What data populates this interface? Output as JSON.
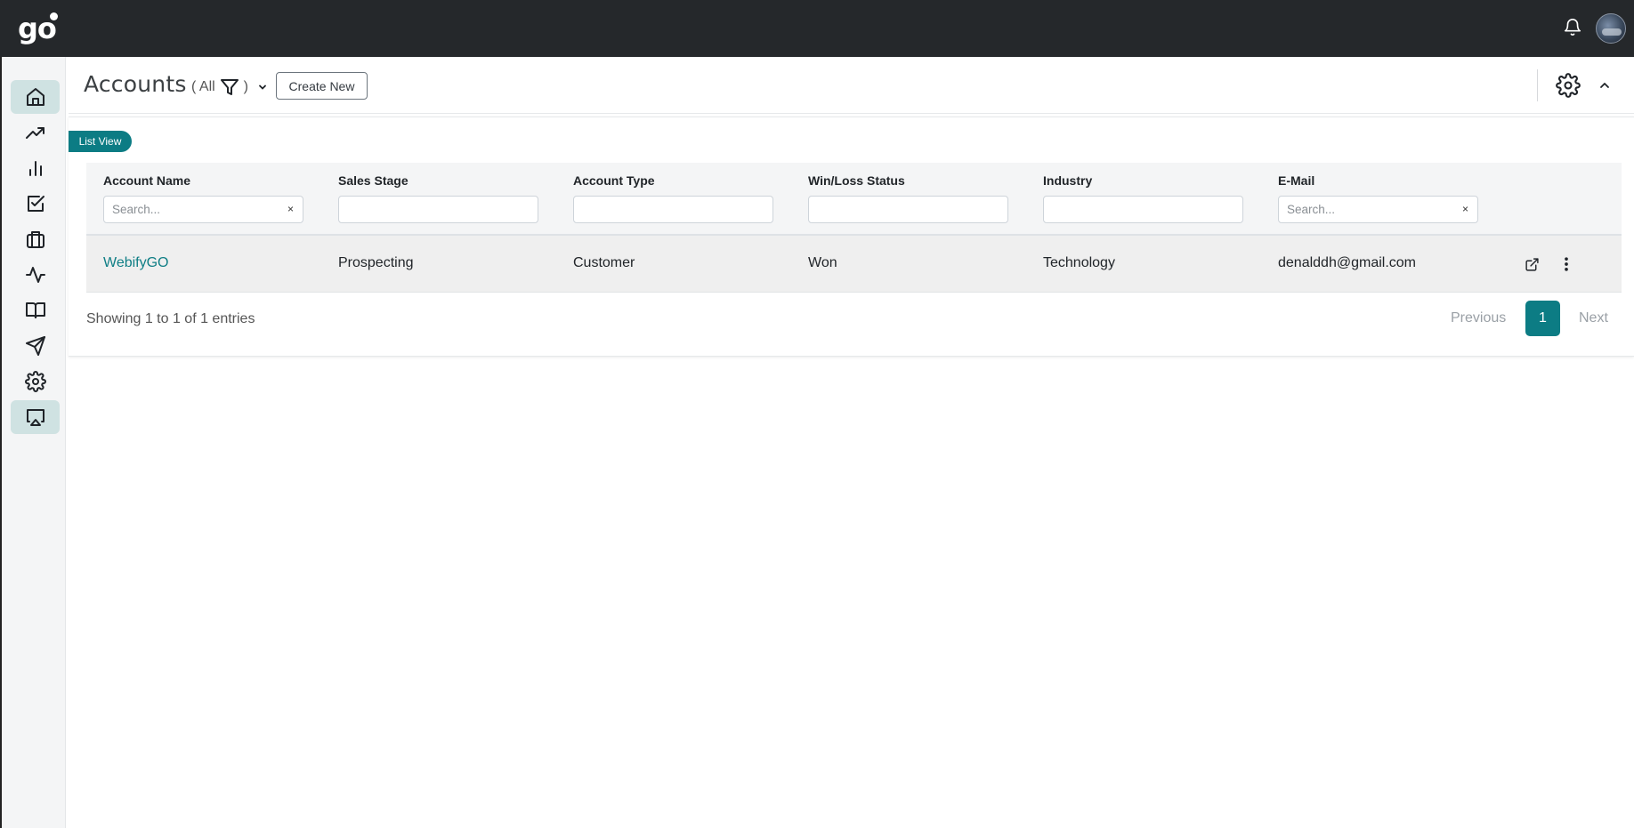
{
  "app": {
    "logo_text": "go"
  },
  "header": {
    "title": "Accounts",
    "filter_open": "( All",
    "filter_close": ")",
    "create_label": "Create New"
  },
  "view_tag": "List View",
  "table": {
    "columns": [
      {
        "label": "Account Name",
        "placeholder": "Search...",
        "clearable": true
      },
      {
        "label": "Sales Stage",
        "placeholder": "",
        "clearable": false
      },
      {
        "label": "Account Type",
        "placeholder": "",
        "clearable": false
      },
      {
        "label": "Win/Loss Status",
        "placeholder": "",
        "clearable": false
      },
      {
        "label": "Industry",
        "placeholder": "",
        "clearable": false
      },
      {
        "label": "E-Mail",
        "placeholder": "Search...",
        "clearable": true
      }
    ],
    "clear_glyph": "×",
    "rows": [
      {
        "account_name": "WebifyGO",
        "sales_stage": "Prospecting",
        "account_type": "Customer",
        "win_loss": "Won",
        "industry": "Technology",
        "email": "denalddh@gmail.com"
      }
    ]
  },
  "footer": {
    "entries_text": "Showing 1 to 1 of 1 entries",
    "prev_label": "Previous",
    "page": "1",
    "next_label": "Next"
  },
  "sidebar": {
    "items": [
      {
        "icon": "home-icon",
        "active": true
      },
      {
        "icon": "trend-up-icon",
        "active": false
      },
      {
        "icon": "bar-chart-icon",
        "active": false
      },
      {
        "icon": "checkbox-icon",
        "active": false
      },
      {
        "icon": "briefcase-icon",
        "active": false
      },
      {
        "icon": "activity-icon",
        "active": false
      },
      {
        "icon": "book-icon",
        "active": false
      },
      {
        "icon": "send-icon",
        "active": false
      },
      {
        "icon": "settings-icon",
        "active": false
      },
      {
        "icon": "presentation-icon",
        "active": true
      }
    ]
  },
  "colors": {
    "accent": "#0c7c84",
    "topbar": "#25282b",
    "active_nav": "#cfe2e2"
  }
}
